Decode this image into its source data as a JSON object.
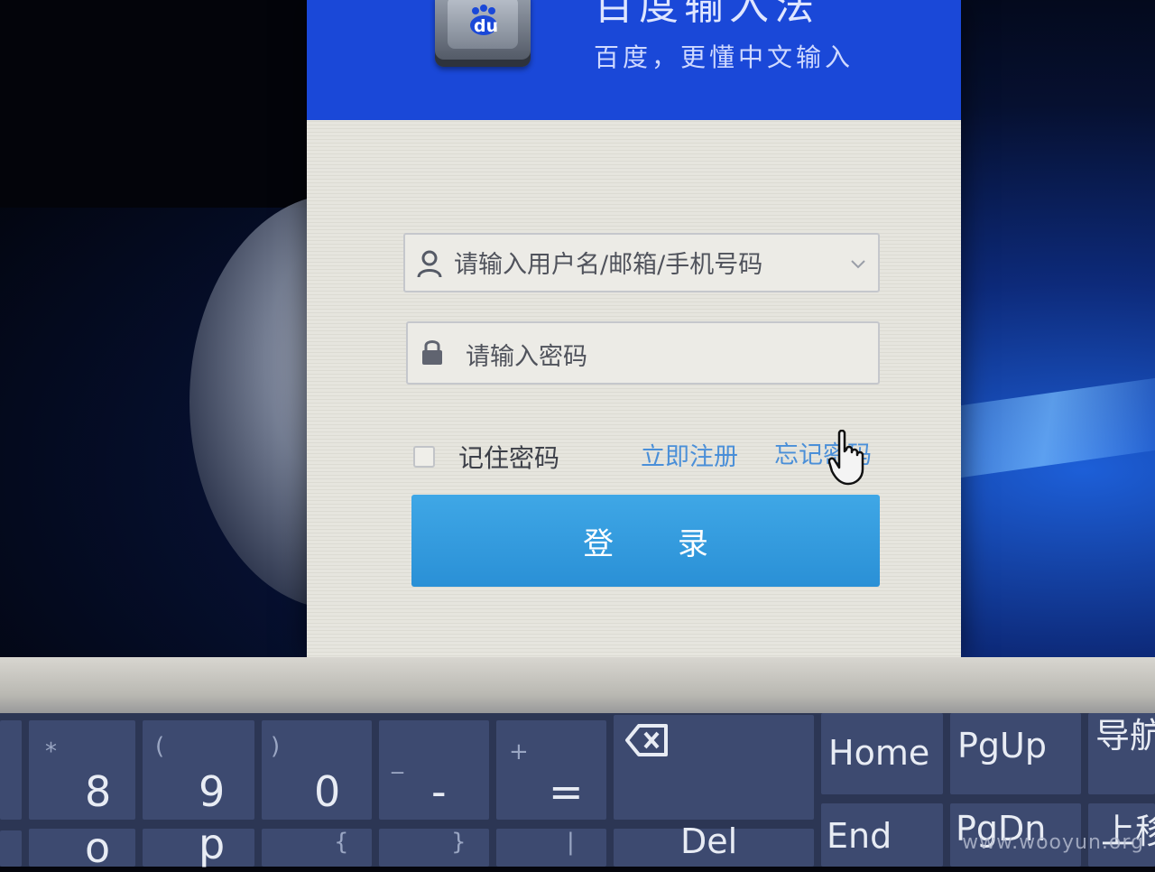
{
  "header": {
    "app_name": "百度输入法",
    "slogan": "百度，更懂中文输入",
    "logo_text": "du"
  },
  "form": {
    "username_placeholder": "请输入用户名/邮箱/手机号码",
    "password_placeholder": "请输入密码",
    "remember_label": "记住密码",
    "register_link": "立即注册",
    "forgot_link": "忘记密码",
    "login_button": "登 录"
  },
  "icons": {
    "user": "user-icon",
    "lock": "lock-icon",
    "dropdown": "chevron-down-icon",
    "cursor": "hand-pointer-icon",
    "backspace": "backspace-icon"
  },
  "colors": {
    "header_blue": "#1a48d8",
    "button_blue": "#2a90d6",
    "link_blue": "#4a8fd8"
  },
  "keyboard": {
    "row1": [
      {
        "main": "8",
        "sub": "*"
      },
      {
        "main": "9",
        "sub": "("
      },
      {
        "main": "0",
        "sub": ")"
      },
      {
        "main": "-",
        "sub": "_"
      },
      {
        "main": "=",
        "sub": "+"
      }
    ],
    "home": "Home",
    "pgup": "PgUp",
    "nav": "导航",
    "row2": [
      {
        "main": "o",
        "sub": ""
      },
      {
        "main": "p",
        "sub": ""
      },
      {
        "main": "[",
        "sub": "{"
      },
      {
        "main": "]",
        "sub": "}"
      },
      {
        "main": "\\",
        "sub": "|"
      }
    ],
    "del": "Del",
    "end": "End",
    "pgdn": "PgDn",
    "move_up": "上移"
  },
  "watermark": "www.wooyun.org"
}
